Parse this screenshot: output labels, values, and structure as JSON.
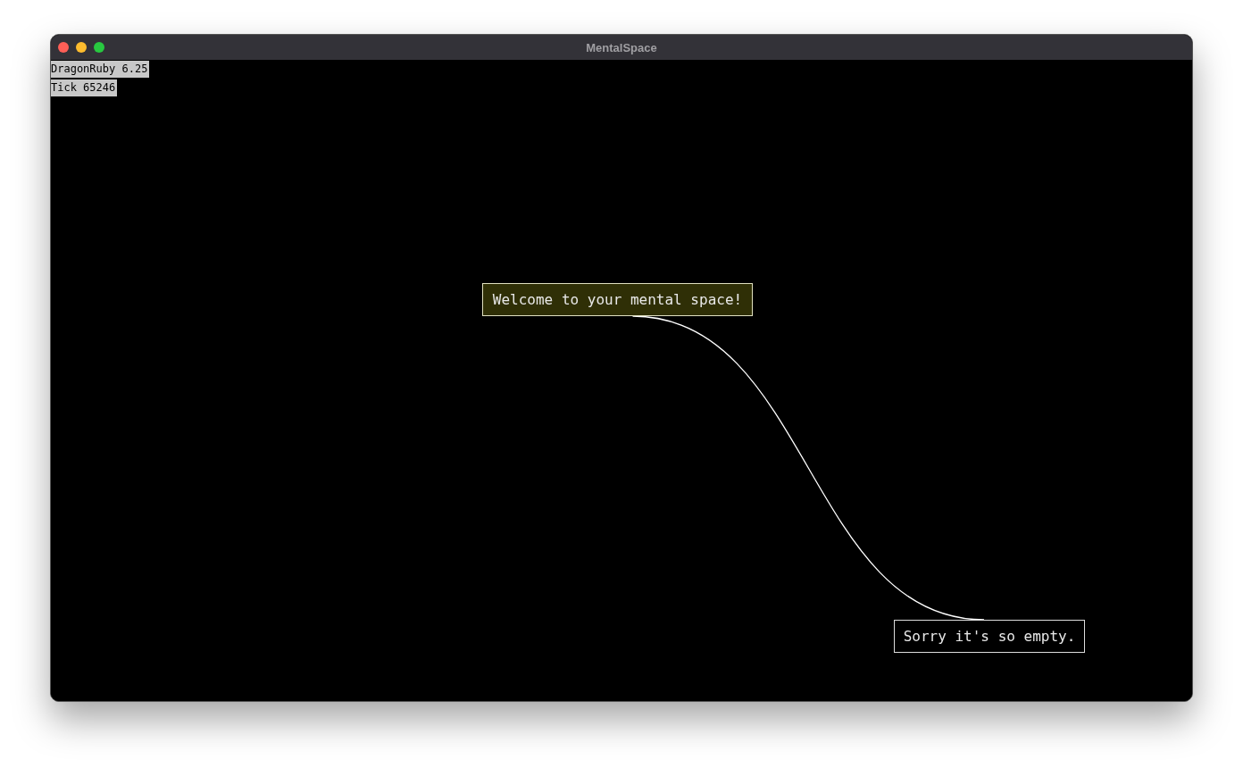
{
  "window": {
    "title": "MentalSpace"
  },
  "debug_lines": [
    "DragonRuby 6.25",
    "Tick 65246"
  ],
  "nodes": [
    {
      "label": "Welcome to your mental space!",
      "selected": true
    },
    {
      "label": "Sorry it's so empty.",
      "selected": false
    }
  ]
}
